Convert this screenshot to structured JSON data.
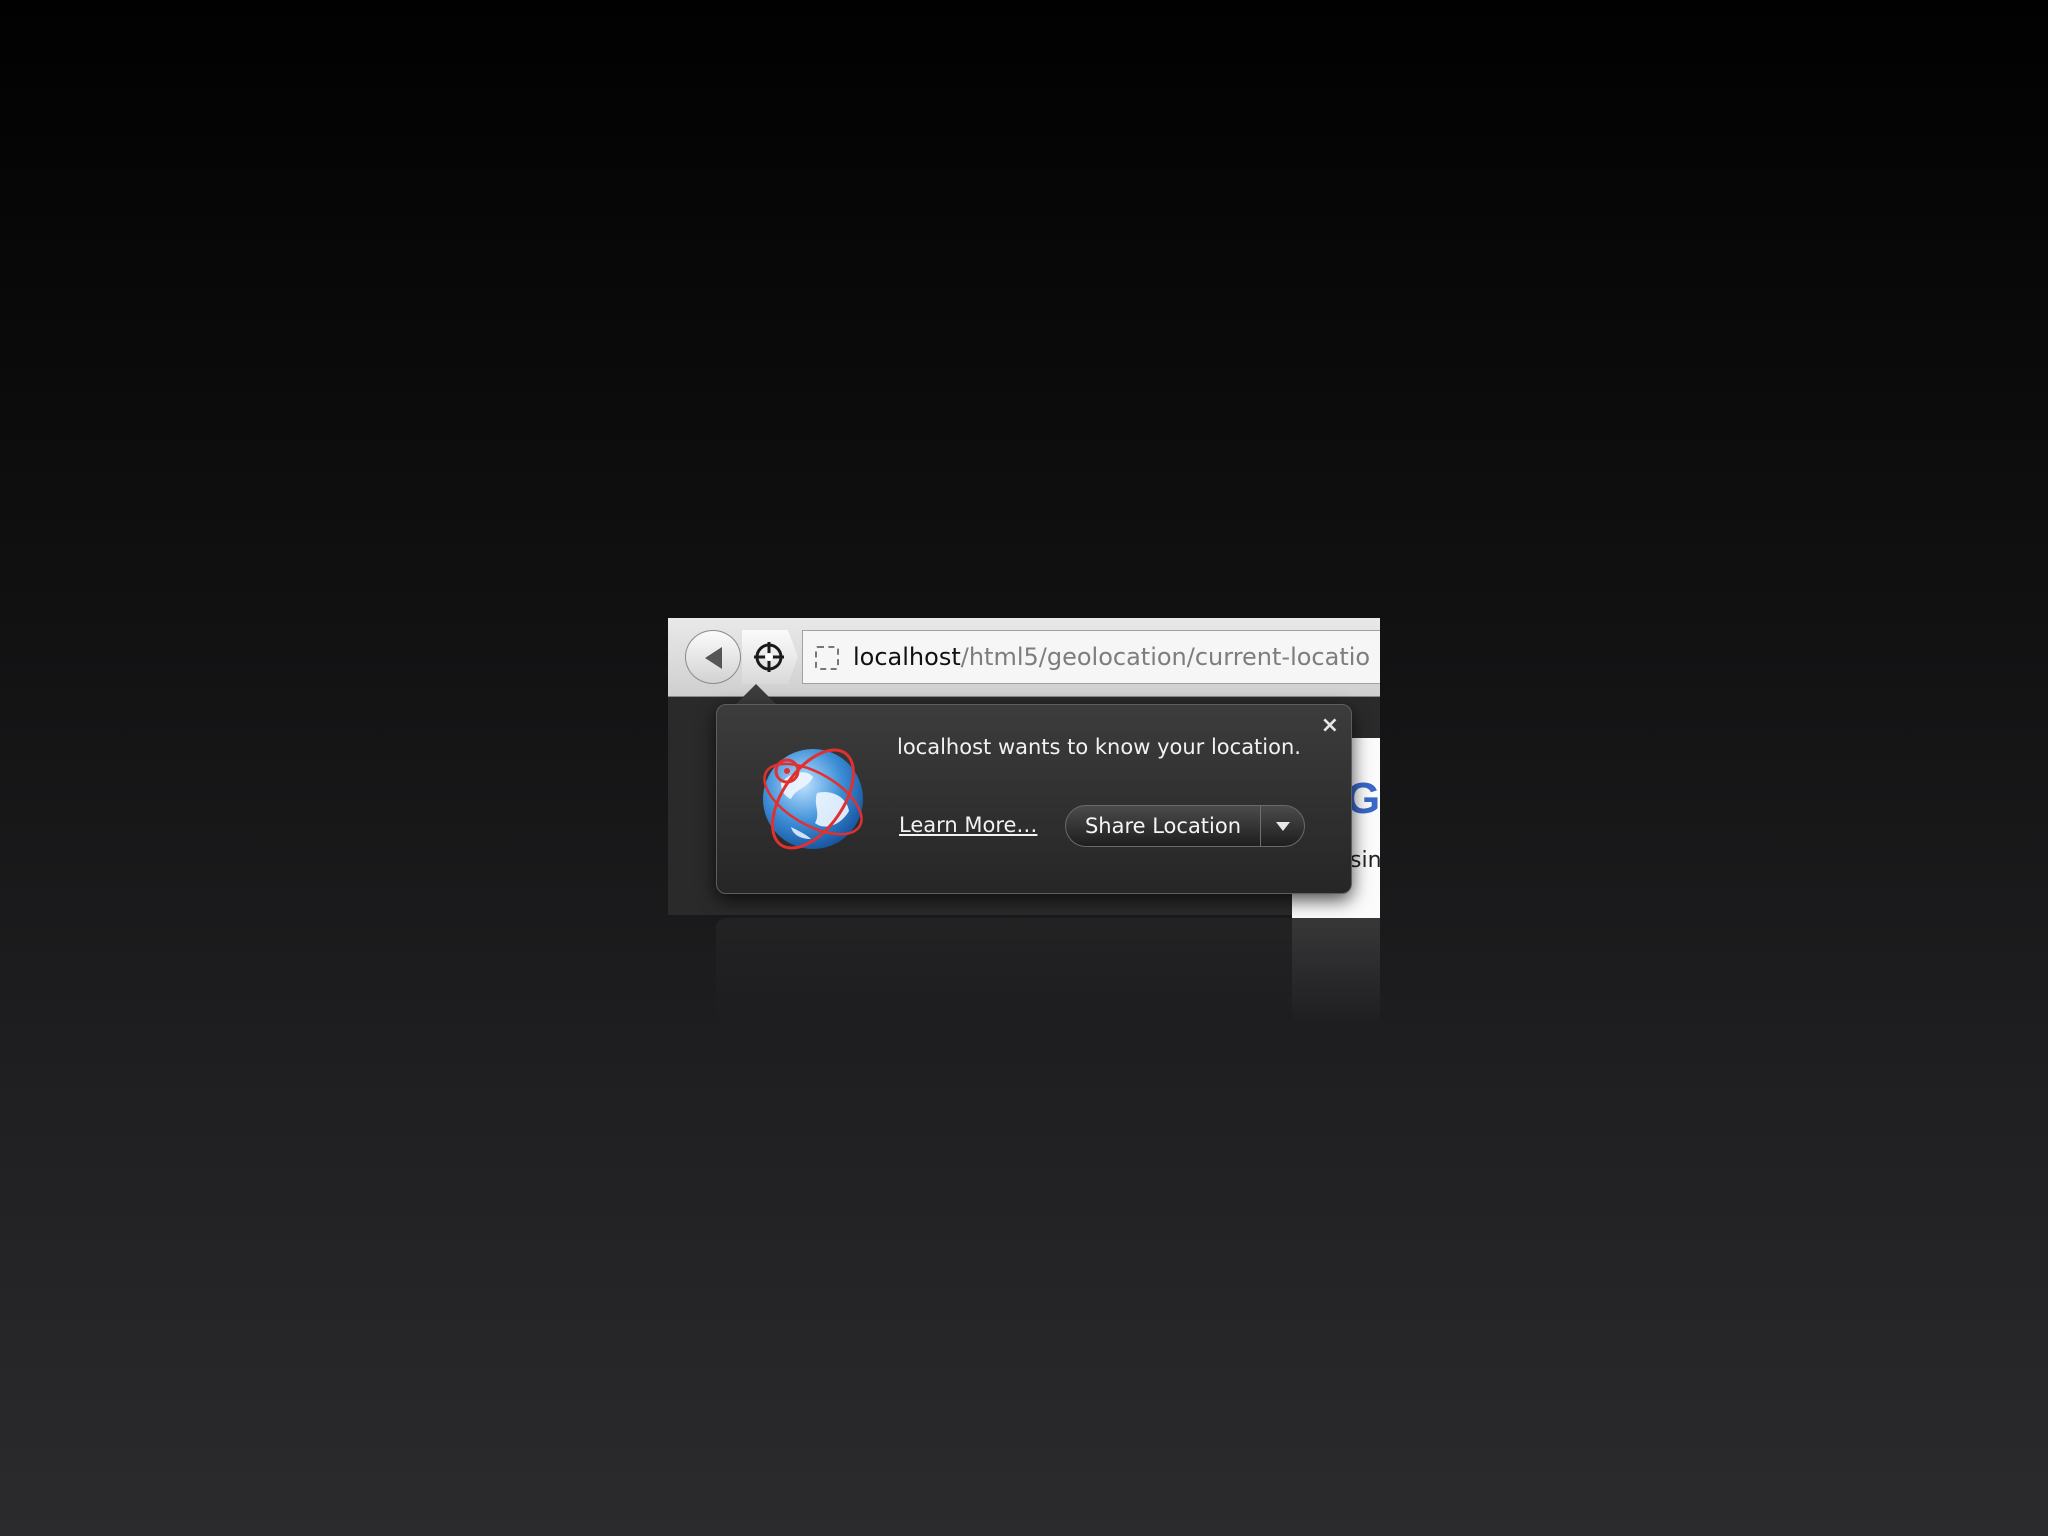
{
  "browser": {
    "url_host": "localhost",
    "url_path": "/html5/geolocation/current-locatio",
    "page_heading_partial": "Ge",
    "page_text_partial": "sin"
  },
  "icons": {
    "back": "back-arrow-icon",
    "locate": "crosshair-target-icon",
    "site": "site-placeholder-icon",
    "globe": "globe-location-icon",
    "close": "close-icon",
    "dropdown": "chevron-down-icon"
  },
  "geolocation_prompt": {
    "message": "localhost wants to know your location.",
    "learn_more": "Learn More…",
    "share_button": "Share Location",
    "close_symbol": "×"
  },
  "colors": {
    "accent_heading": "#3a67c9",
    "globe_ring": "#e03030"
  }
}
